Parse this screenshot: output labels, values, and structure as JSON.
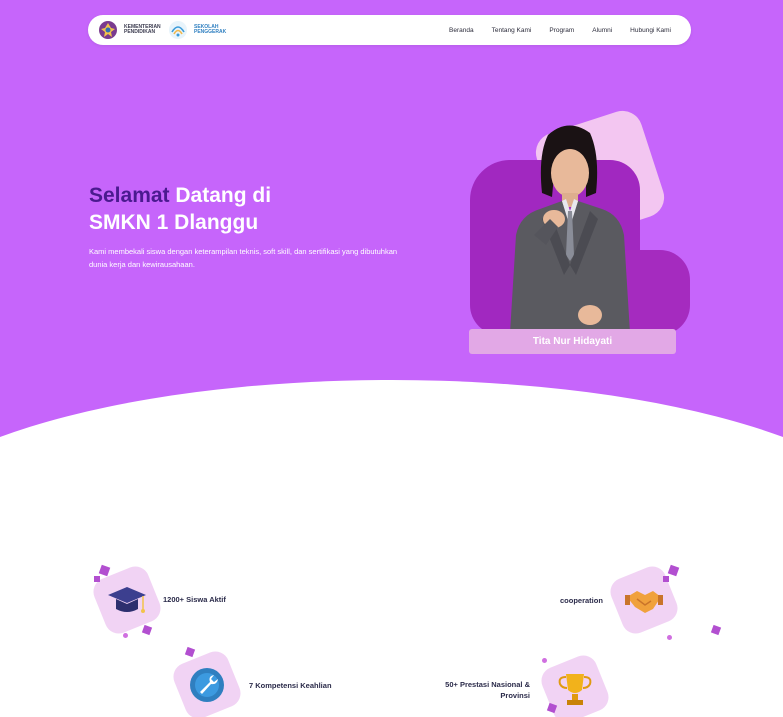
{
  "header": {
    "logo_1_text": "KEMENTERIAN PENDIDIKAN",
    "logo_2_text": "SEKOLAH PENGGERAK",
    "nav": [
      "Beranda",
      "Tentang Kami",
      "Program",
      "Alumni",
      "Hubungi Kami"
    ]
  },
  "hero": {
    "title_accent": "Selamat",
    "title_rest": "Datang di",
    "title_line2": "SMKN 1 Dlanggu",
    "description": "Kami membekali siswa dengan keterampilan teknis, soft skill, dan sertifikasi yang dibutuhkan dunia kerja dan kewirausahaan.",
    "person_name": "Tita Nur Hidayati"
  },
  "features": [
    {
      "label": "1200+ Siswa Aktif",
      "icon": "graduation-cap-icon"
    },
    {
      "label": "cooperation",
      "icon": "handshake-icon"
    },
    {
      "label": "7 Kompetensi Keahlian",
      "icon": "wrench-icon"
    },
    {
      "label": "50+ Prestasi Nasional & Provinsi",
      "icon": "trophy-icon"
    }
  ],
  "colors": {
    "hero_bg": "#c665fb",
    "accent_text": "#4a1a8f",
    "badge_bg": "#f1d3f4",
    "blob_dark": "#a128c0"
  }
}
